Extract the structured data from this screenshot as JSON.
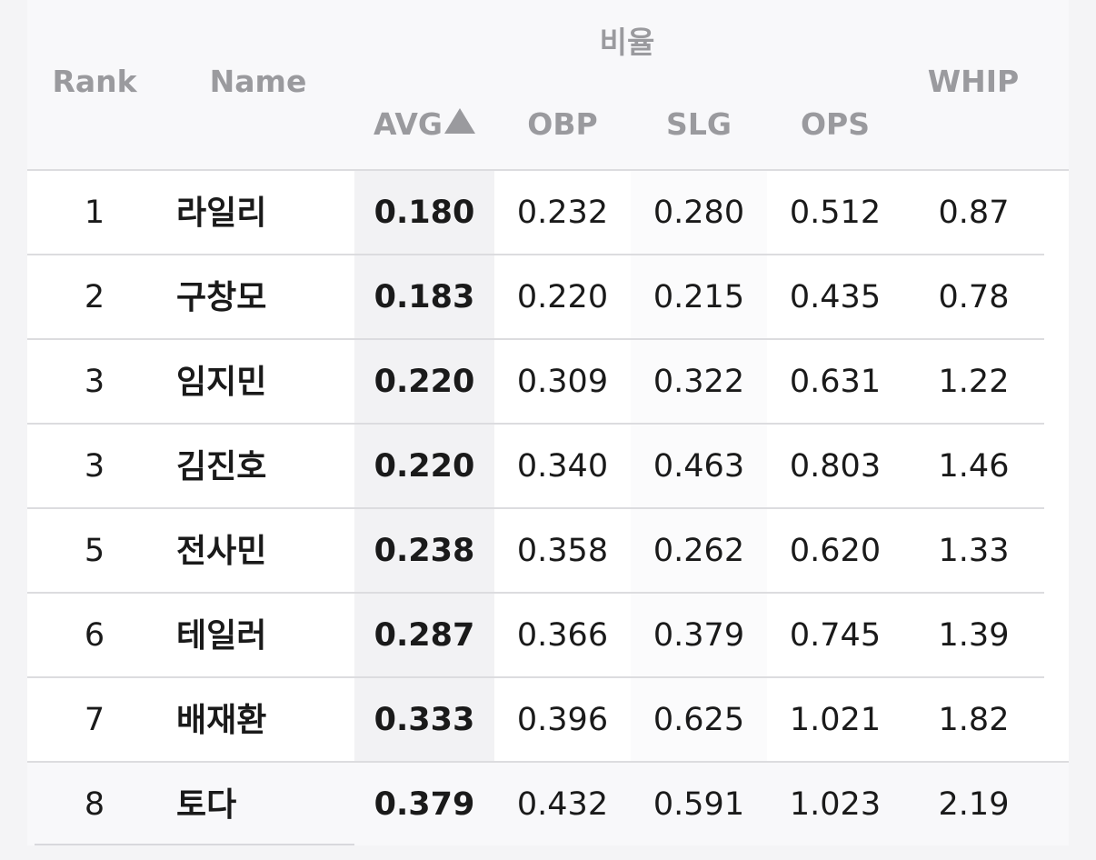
{
  "table": {
    "group_header": "비율",
    "columns": {
      "rank": "Rank",
      "name": "Name",
      "avg": "AVG",
      "obp": "OBP",
      "slg": "SLG",
      "ops": "OPS",
      "whip": "WHIP"
    },
    "sort": {
      "column": "AVG",
      "direction": "ascending",
      "icon": "triangle-up-icon"
    },
    "rows": [
      {
        "rank": "1",
        "name": "라일리",
        "avg": "0.180",
        "obp": "0.232",
        "slg": "0.280",
        "ops": "0.512",
        "whip": "0.87"
      },
      {
        "rank": "2",
        "name": "구창모",
        "avg": "0.183",
        "obp": "0.220",
        "slg": "0.215",
        "ops": "0.435",
        "whip": "0.78"
      },
      {
        "rank": "3",
        "name": "임지민",
        "avg": "0.220",
        "obp": "0.309",
        "slg": "0.322",
        "ops": "0.631",
        "whip": "1.22"
      },
      {
        "rank": "3",
        "name": "김진호",
        "avg": "0.220",
        "obp": "0.340",
        "slg": "0.463",
        "ops": "0.803",
        "whip": "1.46"
      },
      {
        "rank": "5",
        "name": "전사민",
        "avg": "0.238",
        "obp": "0.358",
        "slg": "0.262",
        "ops": "0.620",
        "whip": "1.33"
      },
      {
        "rank": "6",
        "name": "테일러",
        "avg": "0.287",
        "obp": "0.366",
        "slg": "0.379",
        "ops": "0.745",
        "whip": "1.39"
      },
      {
        "rank": "7",
        "name": "배재환",
        "avg": "0.333",
        "obp": "0.396",
        "slg": "0.625",
        "ops": "1.021",
        "whip": "1.82"
      },
      {
        "rank": "8",
        "name": "토다",
        "avg": "0.379",
        "obp": "0.432",
        "slg": "0.591",
        "ops": "1.023",
        "whip": "2.19"
      }
    ]
  },
  "colors": {
    "header_text": "#9a9a9e",
    "row_border": "#dcdcdf",
    "sorted_column_bg": "#f2f2f4",
    "page_bg": "#f4f4f6"
  }
}
